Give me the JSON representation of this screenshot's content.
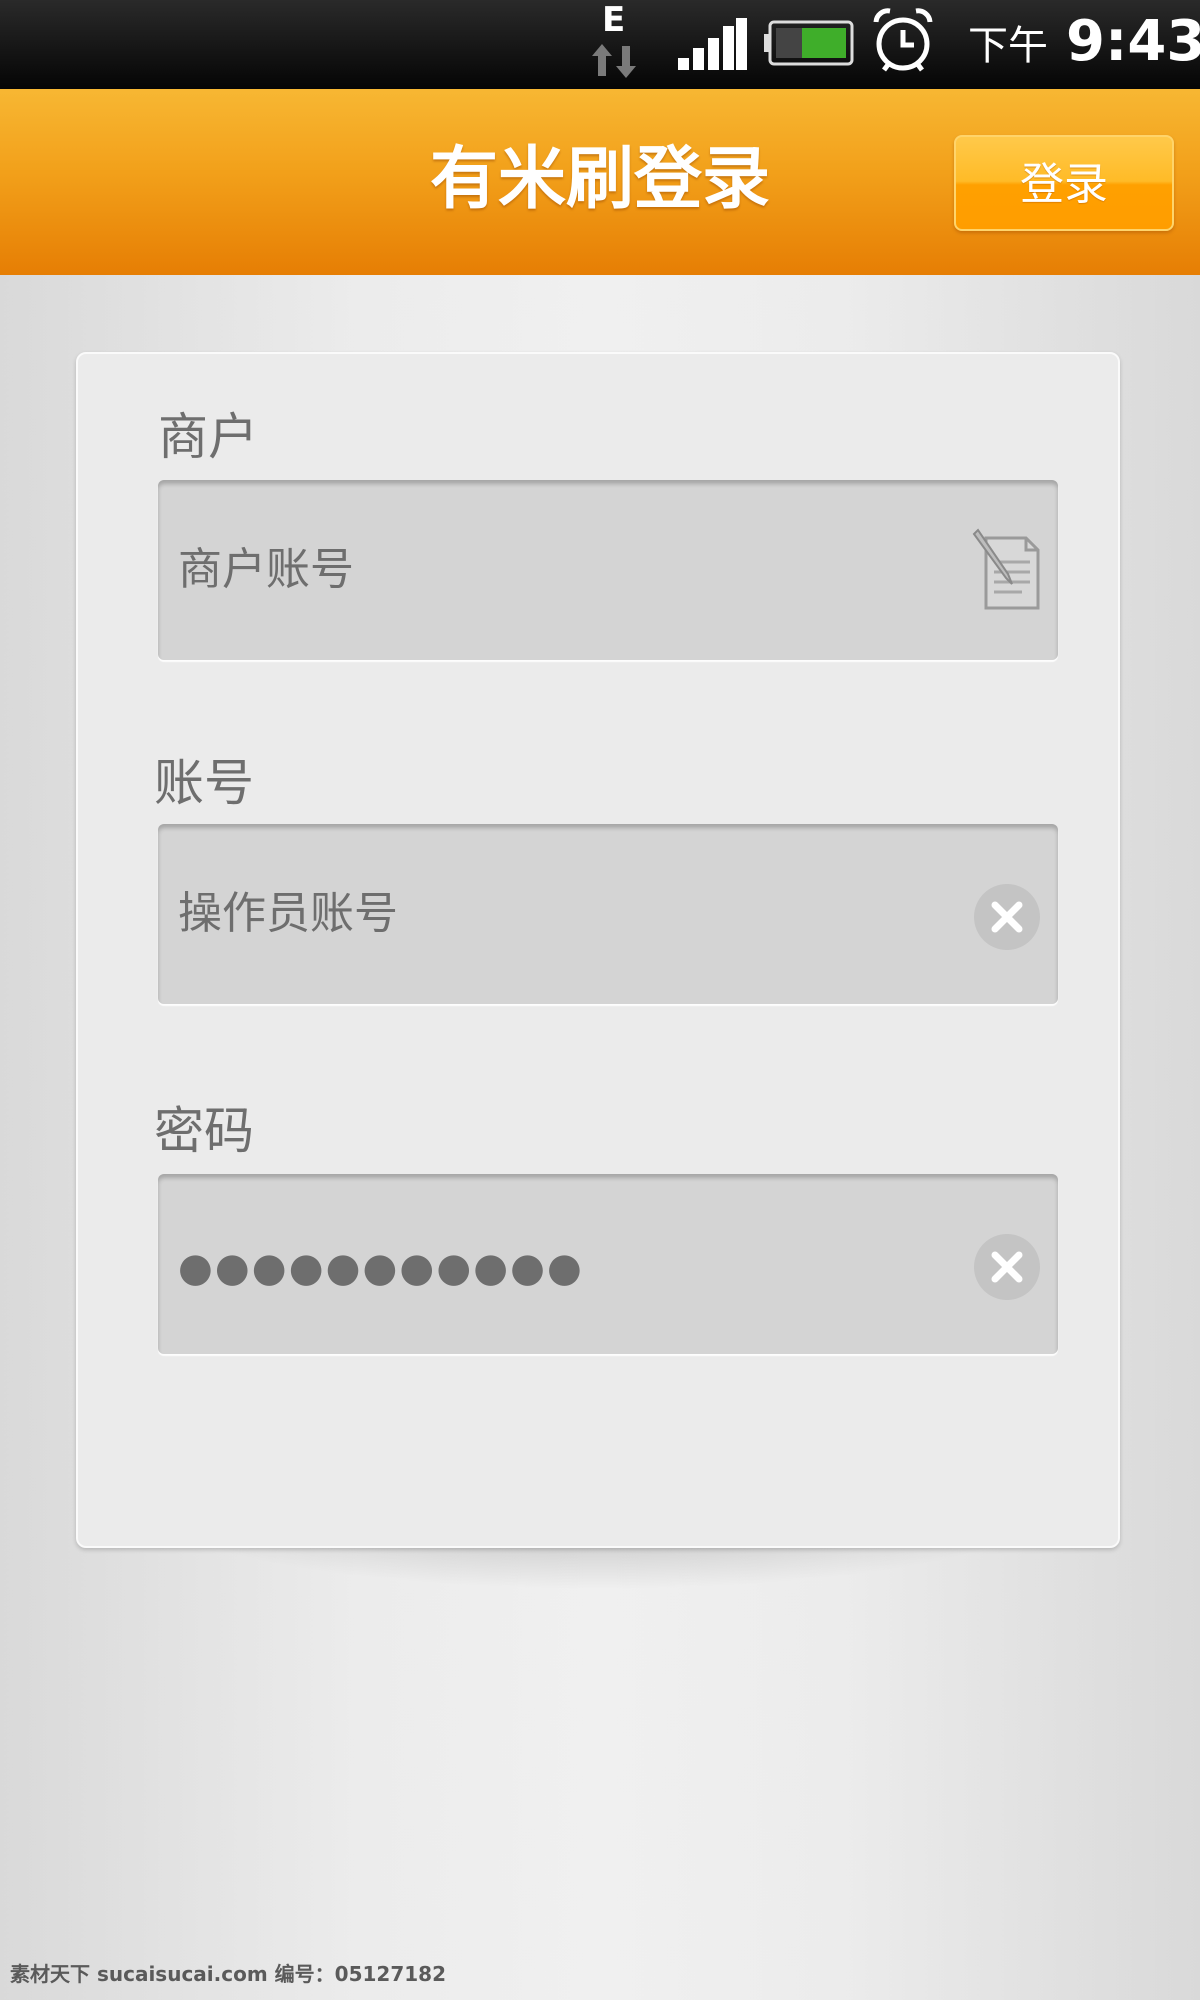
{
  "status_bar": {
    "network_type": "E",
    "ampm": "下午",
    "time": "9:43",
    "icons": [
      "data-arrows-icon",
      "signal-icon",
      "battery-icon",
      "alarm-icon"
    ],
    "colors": {
      "battery": "#3fae2a"
    }
  },
  "header": {
    "title": "有米刷登录",
    "login_button_label": "登录",
    "colors": {
      "header_top": "#f7b733",
      "header_bottom": "#e67e04",
      "button": "#ffb01a"
    }
  },
  "form": {
    "merchant": {
      "label": "商户",
      "placeholder": "商户账号",
      "icon": "notepad-icon"
    },
    "account": {
      "label": "账号",
      "value": "操作员账号",
      "icon": "clear-icon"
    },
    "password": {
      "label": "密码",
      "masked_value": "●●●●●●●●●●●",
      "icon": "clear-icon"
    }
  },
  "watermark": "素材天下 sucaisucai.com 编号：05127182"
}
